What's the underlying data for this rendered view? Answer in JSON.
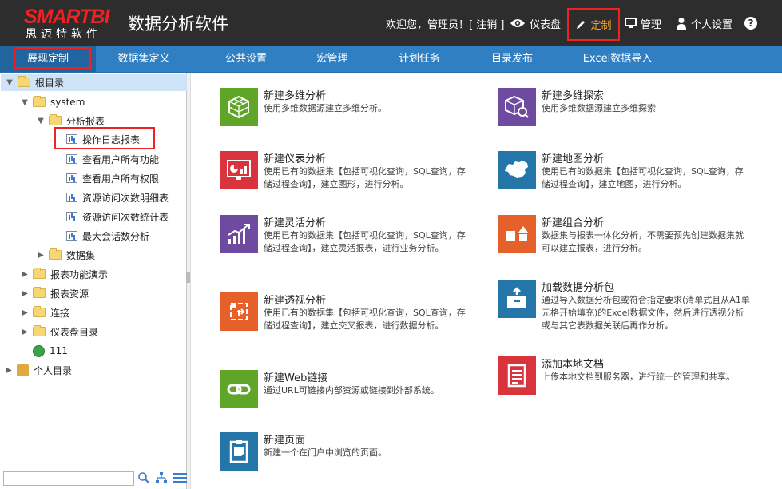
{
  "header": {
    "logo_top": "SMARTBI",
    "logo_bottom": "思迈特软件",
    "app_title": "数据分析软件",
    "welcome": "欢迎您，管理员！[ 注销 ]",
    "dashboard": "仪表盘",
    "custom": "定制",
    "manage": "管理",
    "settings": "个人设置",
    "help": "?"
  },
  "nav": {
    "tabs": [
      "展现定制",
      "数据集定义",
      "公共设置",
      "宏管理",
      "计划任务",
      "目录发布",
      "Excel数据导入"
    ]
  },
  "sidebar": {
    "items": [
      {
        "label": "根目录",
        "type": "folder",
        "arrow": "▼"
      },
      {
        "label": "system",
        "type": "none",
        "arrow": "▼"
      },
      {
        "label": "分析报表",
        "type": "folder",
        "arrow": "▼"
      },
      {
        "label": "操作日志报表",
        "type": "report",
        "arrow": ""
      },
      {
        "label": "查看用户所有功能",
        "type": "report",
        "arrow": ""
      },
      {
        "label": "查看用户所有权限",
        "type": "report",
        "arrow": ""
      },
      {
        "label": "资源访问次数明细表",
        "type": "report",
        "arrow": ""
      },
      {
        "label": "资源访问次数统计表",
        "type": "report",
        "arrow": ""
      },
      {
        "label": "最大会话数分析",
        "type": "report",
        "arrow": ""
      },
      {
        "label": "数据集",
        "type": "folder",
        "arrow": "▶"
      },
      {
        "label": "报表功能演示",
        "type": "folder",
        "arrow": "▶"
      },
      {
        "label": "报表资源",
        "type": "folder",
        "arrow": "▶"
      },
      {
        "label": "连接",
        "type": "folder",
        "arrow": "▶"
      },
      {
        "label": "仪表盘目录",
        "type": "folder",
        "arrow": "▶"
      },
      {
        "label": "111",
        "type": "globe",
        "arrow": ""
      },
      {
        "label": "个人目录",
        "type": "person",
        "arrow": "▶"
      }
    ]
  },
  "cards": [
    {
      "title": "新建多维分析",
      "desc": "使用多维数据源建立多维分析。",
      "color": "#5fa527",
      "icon": "cube-icon"
    },
    {
      "title": "新建多维探索",
      "desc": "使用多维数据源建立多维探索",
      "color": "#6e4aa0",
      "icon": "cube-search-icon"
    },
    {
      "title": "新建仪表分析",
      "desc": "使用已有的数据集【包括可视化查询，SQL查询，存储过程查询】，建立图形，进行分析。",
      "color": "#d9343d",
      "icon": "dashboard-icon"
    },
    {
      "title": "新建地图分析",
      "desc": "使用已有的数据集【包括可视化查询，SQL查询，存储过程查询】，建立地图，进行分析。",
      "color": "#2376a7",
      "icon": "map-icon"
    },
    {
      "title": "新建灵活分析",
      "desc": "使用已有的数据集【包括可视化查询，SQL查询，存储过程查询】，建立灵活报表，进行业务分析。",
      "color": "#6e4aa0",
      "icon": "growth-chart-icon"
    },
    {
      "title": "新建组合分析",
      "desc": "数据集与报表一体化分析，不需要预先创建数据集就可以建立报表，进行分析。",
      "color": "#e5602b",
      "icon": "shapes-icon"
    },
    {
      "title": "新建透视分析",
      "desc": "使用已有的数据集【包括可视化查询，SQL查询，存储过程查询】，建立交叉报表，进行数据分析。",
      "color": "#e5602b",
      "icon": "pivot-icon"
    },
    {
      "title": "加载数据分析包",
      "desc": "通过导入数据分析包或符合指定要求(清单式且从A1单元格开始填充)的Excel数据文件，然后进行透视分析或与其它表数据关联后再作分析。",
      "color": "#2376a7",
      "icon": "upload-box-icon"
    },
    {
      "title": "新建Web链接",
      "desc": "通过URL可链接内部资源或链接到外部系统。",
      "color": "#5fa527",
      "icon": "link-icon"
    },
    {
      "title": "添加本地文档",
      "desc": "上传本地文档到服务器，进行统一的管理和共享。",
      "color": "#d9343d",
      "icon": "document-icon"
    },
    {
      "title": "新建页面",
      "desc": "新建一个在门户中浏览的页面。",
      "color": "#2376a7",
      "icon": "page-icon"
    }
  ]
}
